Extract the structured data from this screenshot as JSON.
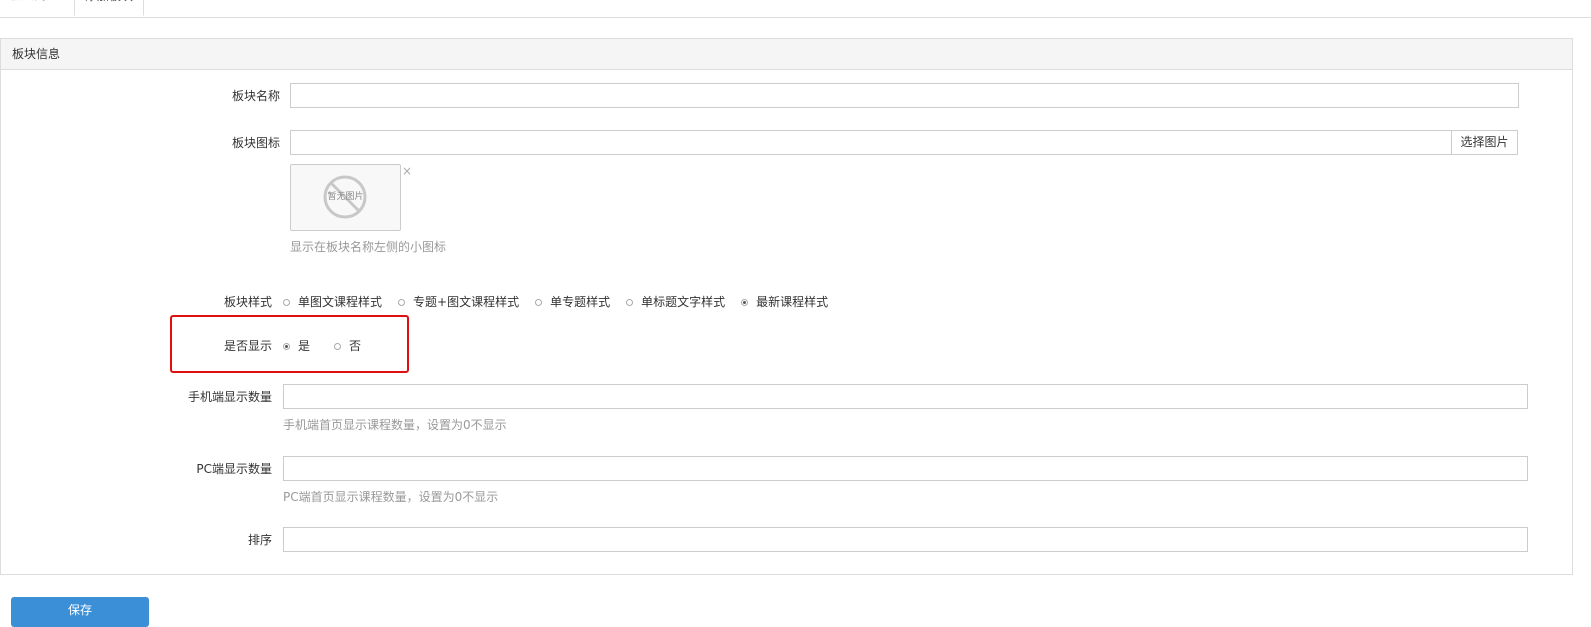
{
  "tabs": [
    {
      "label": "板块列表"
    },
    {
      "label": "添加板块"
    }
  ],
  "panel": {
    "title": "板块信息"
  },
  "form": {
    "name": {
      "label": "板块名称",
      "value": ""
    },
    "icon": {
      "label": "板块图标",
      "value": "",
      "select_button": "选择图片",
      "thumb_placeholder": "暂无图片",
      "remove_glyph": "×",
      "help": "显示在板块名称左侧的小图标"
    },
    "style": {
      "label": "板块样式",
      "options": [
        "单图文课程样式",
        "专题+图文课程样式",
        "单专题样式",
        "单标题文字样式",
        "最新课程样式"
      ],
      "selected": "最新课程样式"
    },
    "visible": {
      "label": "是否显示",
      "options": [
        "是",
        "否"
      ],
      "selected": "是"
    },
    "mobile_count": {
      "label": "手机端显示数量",
      "value": "",
      "help": "手机端首页显示课程数量，设置为0不显示"
    },
    "pc_count": {
      "label": "PC端显示数量",
      "value": "",
      "help": "PC端首页显示课程数量，设置为0不显示"
    },
    "sort": {
      "label": "排序",
      "value": ""
    }
  },
  "actions": {
    "save": "保存"
  },
  "colors": {
    "primary": "#3b8fd6",
    "highlight": "#e01010"
  }
}
